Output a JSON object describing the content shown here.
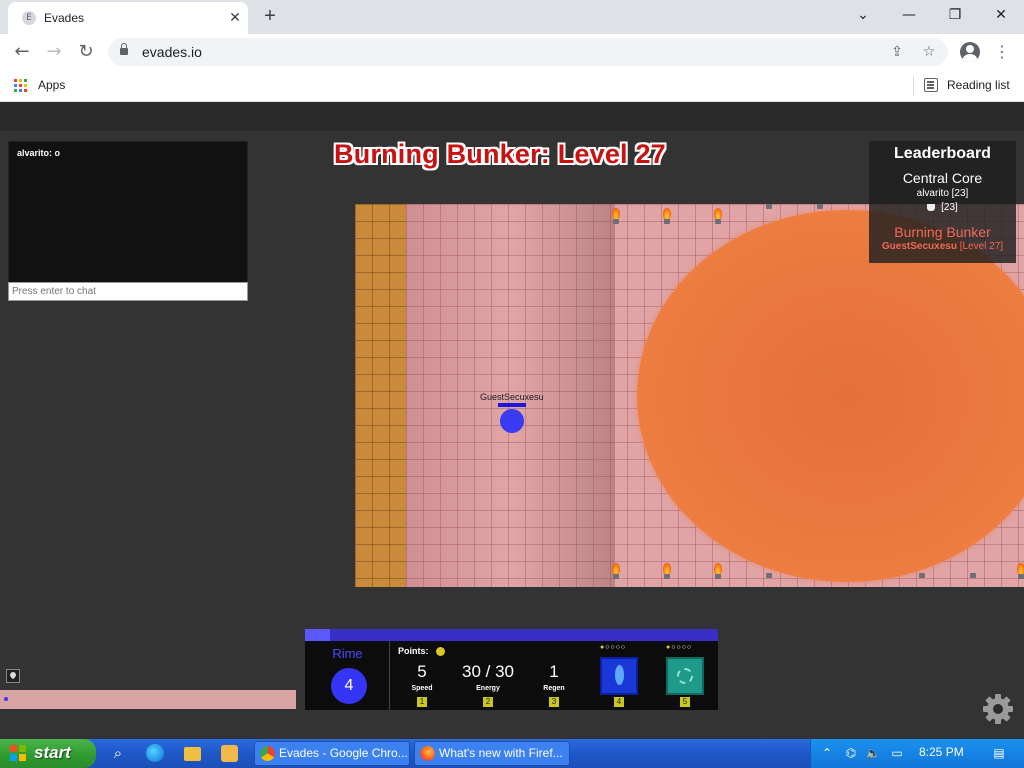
{
  "browser": {
    "tab_title": "Evades",
    "tab_favicon": "E",
    "url": "evades.io",
    "bookmarks": {
      "apps": "Apps",
      "reading_list": "Reading list"
    }
  },
  "chat": {
    "messages": [
      {
        "text": "alvarito: o"
      }
    ],
    "input_placeholder": "Press enter to chat"
  },
  "game": {
    "area_title": "Burning Bunker: Level 27",
    "player_name": "GuestSecuxesu"
  },
  "leaderboard": {
    "title": "Leaderboard",
    "groups": [
      {
        "area": "Central Core",
        "players": [
          {
            "text": "alvarito [23]"
          },
          {
            "text": "[23]"
          }
        ]
      },
      {
        "area": "Burning Bunker",
        "players": [
          {
            "name": "GuestSecuxesu",
            "level": "[Level 27]"
          }
        ]
      }
    ]
  },
  "hud": {
    "hero_name": "Rime",
    "hero_level": "4",
    "xp_progress": 0.06,
    "points_label": "Points:",
    "stats": [
      {
        "value": "5",
        "label": "Speed",
        "key": "1"
      },
      {
        "value": "30 / 30",
        "label": "Energy",
        "key": "2"
      },
      {
        "value": "1",
        "label": "Regen",
        "key": "3"
      }
    ],
    "abilities": [
      {
        "key": "4",
        "level": 1,
        "max": 5
      },
      {
        "key": "5",
        "level": 1,
        "max": 5
      }
    ]
  },
  "taskbar": {
    "start_label": "start",
    "tasks": [
      {
        "label": "Evades - Google Chro..."
      },
      {
        "label": "What's new with Firef..."
      }
    ],
    "clock": "8:25 PM"
  },
  "colors": {
    "title_red": "#c81212",
    "player_blue": "#3a3af0",
    "enemy_orange": "#ec7a3f",
    "safe_zone": "#c98a3c",
    "leaderboard_self": "#ef6a5a"
  }
}
